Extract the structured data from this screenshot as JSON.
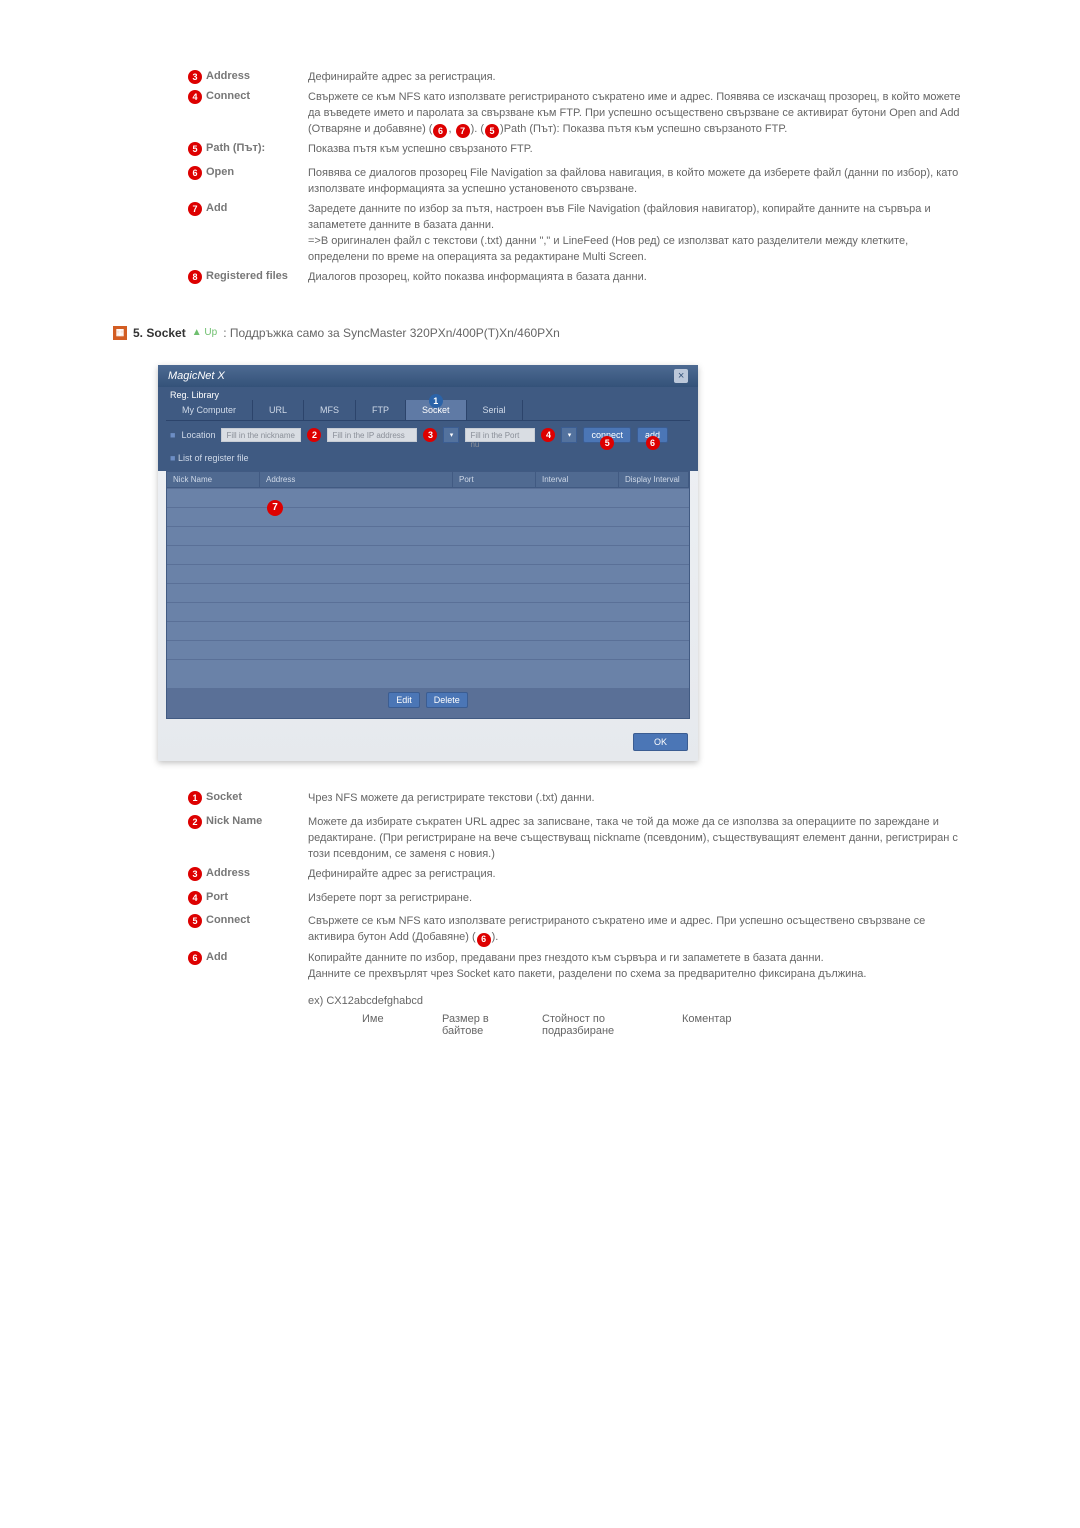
{
  "items1": [
    {
      "n": "3",
      "label": "Address",
      "text": "Дефинирайте адрес за регистрация."
    },
    {
      "n": "4",
      "label": "Connect",
      "text_a": "Свържете се към NFS като използвате регистрираното съкратено име и адрес. Появява се изскачащ прозорец, в който можете да въведете името и паролата за свързване към FTP. При успешно осъществено свързване се активират бутони Open and Add (Отваряне и добавяне) (",
      "text_b": ", ",
      "text_c": "). (",
      "text_d": ")Path (Път): Показва пътя към успешно свързаното FTP.",
      "refs": [
        "6",
        "7",
        "5"
      ]
    },
    {
      "n": "5",
      "label": "Path (Път):",
      "text": "Показва пътя към успешно свързаното FTP."
    },
    {
      "n": "6",
      "label": "Open",
      "text": "Появява се диалогов прозорец File Navigation за файлова навигация, в който можете да изберете файл (данни по избор), като използвате информацията за успешно установеното свързване."
    },
    {
      "n": "7",
      "label": "Add",
      "text": "Заредете данните по избор за пътя, настроен във File Navigation (файловия навигатор), копирайте данните на сървъра и запаметете данните в базата данни.\n=>В оригинален файл с текстови (.txt) данни \",\" и LineFeed (Нов ред) се използват като разделители между клетките, определени по време на операцията за редактиране Multi Screen."
    },
    {
      "n": "8",
      "label": "Registered files",
      "text": "Диалогов прозорец, който показва информацията в базата данни."
    }
  ],
  "section": {
    "num": "5.",
    "title": "Socket",
    "up": "▲ Up",
    "subtitle": ": Поддръжка само за SyncMaster 320PXn/400P(T)Xn/460PXn"
  },
  "panel": {
    "title": "MagicNet X",
    "subtab": "Reg. Library",
    "tabs": [
      "My Computer",
      "URL",
      "MFS",
      "FTP",
      "Socket",
      "Serial"
    ],
    "row2": {
      "location": "Location",
      "nick": "Fill in the nickname",
      "ip": "Fill in the IP address",
      "port": "Fill in the Port nu",
      "connect": "connect",
      "add": "add"
    },
    "row3": "List of register file",
    "cols": [
      "Nick Name",
      "Address",
      "Port",
      "Interval",
      "Display Interval"
    ],
    "edit": "Edit",
    "delete": "Delete",
    "ok": "OK"
  },
  "items2": [
    {
      "n": "1",
      "label": "Socket",
      "text": "Чрез NFS можете да регистрирате текстови (.txt) данни."
    },
    {
      "n": "2",
      "label": "Nick Name",
      "text": "Можете да избирате съкратен URL адрес за записване, така че той да може да се използва за операциите по зареждане и редактиране. (При регистриране на вече съществуващ nickname (псевдоним), съществуващият елемент данни, регистриран с този псевдоним, се заменя с новия.)"
    },
    {
      "n": "3",
      "label": "Address",
      "text": "Дефинирайте адрес за регистрация."
    },
    {
      "n": "4",
      "label": "Port",
      "text": "Изберете порт за регистриране."
    },
    {
      "n": "5",
      "label": "Connect",
      "text_a": "Свържете се към NFS като използвате регистрираното съкратено име и адрес. При успешно осъществено свързване се активира бутон Add (Добавяне) (",
      "text_b": ").",
      "refs": [
        "6"
      ]
    },
    {
      "n": "6",
      "label": "Add",
      "text": "Копирайте данните по избор, предавани през гнездото към сървъра и ги запаметете в базата данни.\nДанните се прехвърлят чрез Socket като пакети, разделени по схема за предварително фиксирана дължина."
    }
  ],
  "example": {
    "caption": "ex) CX12abcdefghabcd",
    "cols": [
      "Име",
      "Размер в\nбайтове",
      "Стойност по\nподразбиране",
      "Коментар"
    ]
  }
}
